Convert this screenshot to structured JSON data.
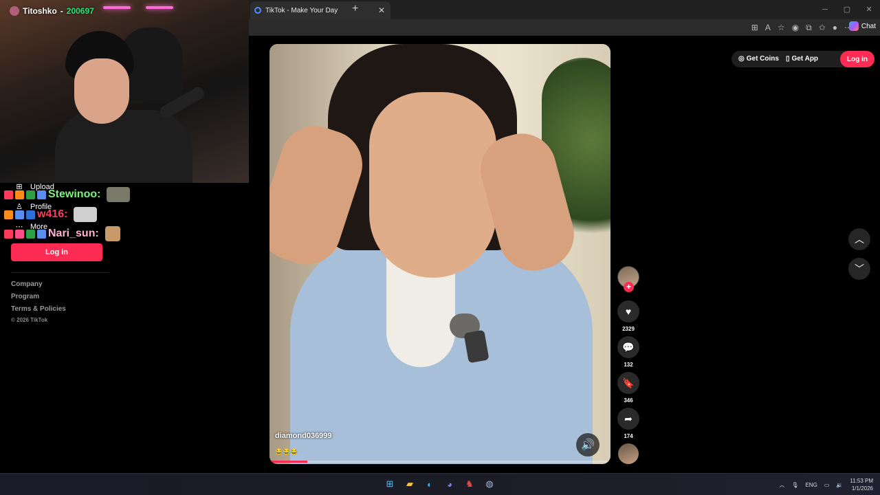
{
  "browser": {
    "tab_title": "TikTok - Make Your Day",
    "tab_close": "✕",
    "new_tab": "+",
    "win_min": "─",
    "win_max": "▢",
    "win_close": "✕",
    "copilot_label": "Chat"
  },
  "stream": {
    "username": "Titoshko",
    "user_number": "200697"
  },
  "chat": [
    {
      "user": "Stewinoo:",
      "color": "#7cf27c"
    },
    {
      "user": "w416:",
      "color": "#ff3b5c"
    },
    {
      "user": "Nari_sun:",
      "color": "#ffb3d1"
    }
  ],
  "sidebar": {
    "nav": [
      {
        "icon": "upload-icon",
        "label": "Upload"
      },
      {
        "icon": "profile-icon",
        "label": "Profile"
      },
      {
        "icon": "more-icon",
        "label": "More"
      }
    ],
    "login_label": "Log in",
    "footer_links": [
      "Company",
      "Program",
      "Terms & Policies"
    ],
    "copyright": "© 2026 TikTok"
  },
  "header": {
    "get_coins": "Get Coins",
    "get_app": "Get App",
    "login": "Log in"
  },
  "video": {
    "username": "diamond036999",
    "caption": "😂😂😂",
    "progress": 0.11
  },
  "actions": {
    "likes": "2329",
    "comments": "132",
    "saves": "346",
    "shares": "174"
  },
  "taskbar": {
    "language": "ENG",
    "time": "11:53 PM",
    "date": "1/1/2026"
  },
  "colors": {
    "accent": "#fe2c55",
    "background": "#000000"
  }
}
